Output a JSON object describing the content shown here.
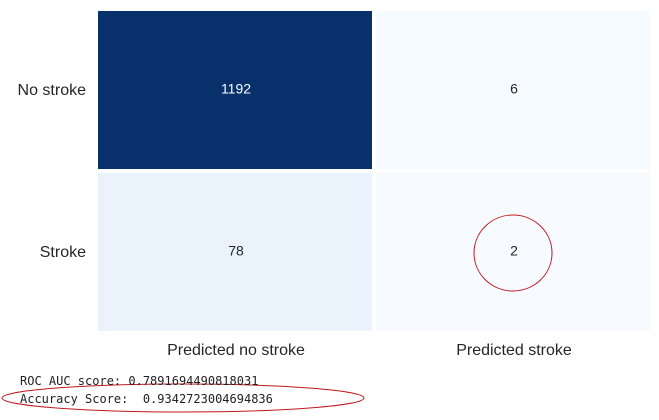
{
  "chart_data": {
    "type": "heatmap",
    "row_labels": [
      "No stroke",
      "Stroke"
    ],
    "col_labels": [
      "Predicted no stroke",
      "Predicted stroke"
    ],
    "values": [
      [
        1192,
        6
      ],
      [
        78,
        2
      ]
    ],
    "colormap": "Blues",
    "colors": {
      "max": "#08306b",
      "min": "#f7fbff",
      "cell_78": "#eaf3fb",
      "highlight_ring": "#c0181e"
    },
    "highlighted_cell": {
      "row": 1,
      "col": 1
    }
  },
  "output_text": {
    "roc_auc": "ROC AUC score: 0.7891694490818031",
    "accuracy": "Accuracy Score:  0.9342723004694836"
  }
}
